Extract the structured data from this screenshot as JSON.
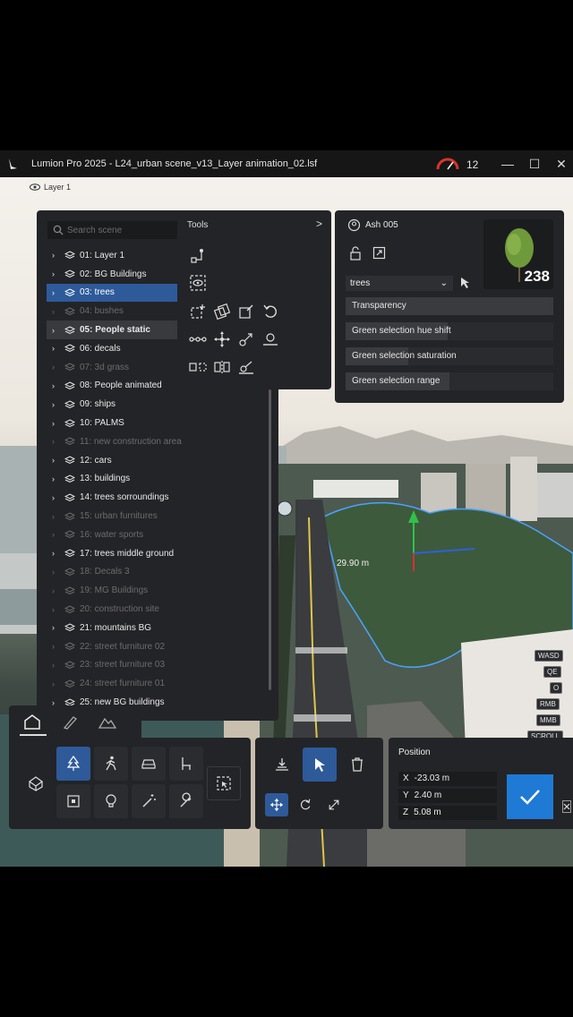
{
  "window": {
    "title": "Lumion Pro 2025 - L24_urban scene_v13_Layer animation_02.lsf",
    "performance_count": "12"
  },
  "viewport": {
    "layer_tag": "Layer 1",
    "distance_label": "29.90 m"
  },
  "scene": {
    "search_placeholder": "Search scene",
    "items": [
      {
        "label": "01: Layer 1",
        "state": "normal"
      },
      {
        "label": "02: BG Buildings",
        "state": "normal"
      },
      {
        "label": "03: trees",
        "state": "selected"
      },
      {
        "label": "04: bushes",
        "state": "hidden"
      },
      {
        "label": "05: People static",
        "state": "hover"
      },
      {
        "label": "06: decals",
        "state": "normal"
      },
      {
        "label": "07: 3d grass",
        "state": "hidden"
      },
      {
        "label": "08: People animated",
        "state": "normal"
      },
      {
        "label": "09: ships",
        "state": "normal"
      },
      {
        "label": "10: PALMS",
        "state": "normal"
      },
      {
        "label": "11: new construction area",
        "state": "hidden"
      },
      {
        "label": "12: cars",
        "state": "normal"
      },
      {
        "label": "13: buildings",
        "state": "normal"
      },
      {
        "label": "14: trees sorroundings",
        "state": "normal"
      },
      {
        "label": "15: urban furnitures",
        "state": "hidden"
      },
      {
        "label": "16: water sports",
        "state": "hidden"
      },
      {
        "label": "17: trees middle ground",
        "state": "normal"
      },
      {
        "label": "18: Decals 3",
        "state": "hidden"
      },
      {
        "label": "19: MG Buildings",
        "state": "hidden"
      },
      {
        "label": "20: construction site",
        "state": "hidden"
      },
      {
        "label": "21: mountains BG",
        "state": "normal"
      },
      {
        "label": "22: street furniture 02",
        "state": "hidden"
      },
      {
        "label": "23: street furniture 03",
        "state": "hidden"
      },
      {
        "label": "24: street furniture 01",
        "state": "hidden"
      },
      {
        "label": "25: new BG buildings",
        "state": "normal"
      }
    ]
  },
  "tools": {
    "title": "Tools"
  },
  "object_info": {
    "name": "Ash 005",
    "count": "238",
    "layer_value": "trees",
    "settings": [
      {
        "label": "Transparency",
        "level": 1.0
      },
      {
        "label": "Green selection hue shift",
        "level": 0.49
      },
      {
        "label": "Green selection saturation",
        "level": 0.3
      },
      {
        "label": "Green selection range",
        "level": 0.5
      }
    ]
  },
  "keys": [
    "WASD",
    "QE",
    "O",
    "RMB",
    "MMB",
    "SCROLL"
  ],
  "position": {
    "title": "Position",
    "x": {
      "axis": "X",
      "value": "-23.03 m"
    },
    "y": {
      "axis": "Y",
      "value": "2.40 m"
    },
    "z": {
      "axis": "Z",
      "value": "5.08 m"
    }
  },
  "colors": {
    "accent": "#2e5a9a",
    "confirm": "#1f7ad6",
    "panel": "#232427"
  }
}
